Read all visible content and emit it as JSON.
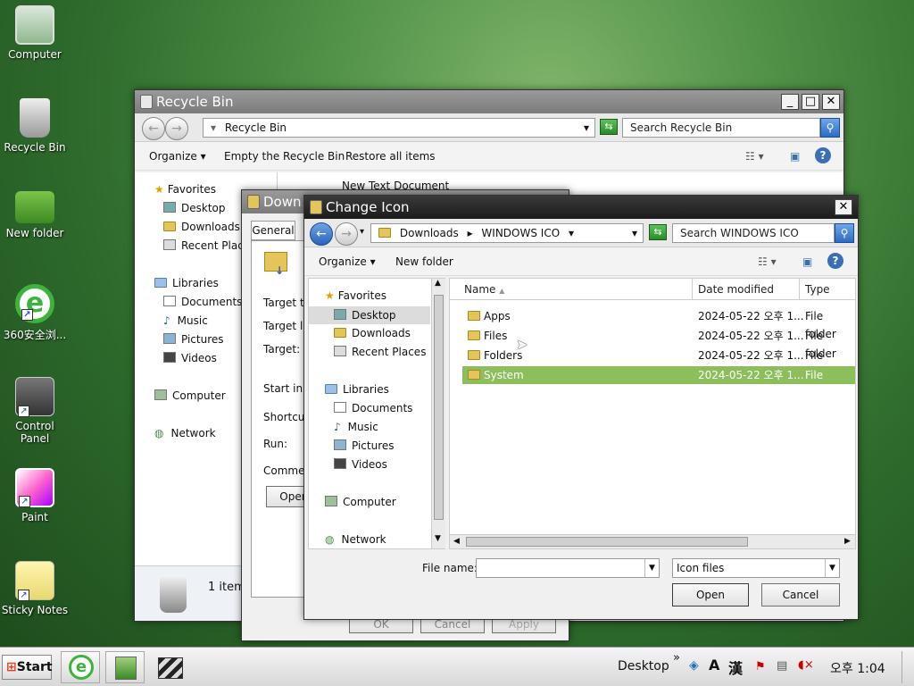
{
  "desktop": {
    "icons": [
      {
        "label": "Computer"
      },
      {
        "label": "Recycle Bin"
      },
      {
        "label": "New folder"
      },
      {
        "label": "360安全浏..."
      },
      {
        "label": "Control Panel"
      },
      {
        "label": "Paint"
      },
      {
        "label": "Sticky Notes"
      }
    ]
  },
  "recycle_bin": {
    "title": "Recycle Bin",
    "address": "Recycle Bin",
    "search_placeholder": "Search Recycle Bin",
    "commands": [
      "Organize",
      "Empty the Recycle Bin",
      "Restore all items"
    ],
    "nav": {
      "favorites": "Favorites",
      "desktop": "Desktop",
      "downloads": "Downloads",
      "recent": "Recent Places",
      "libraries": "Libraries",
      "documents": "Documents",
      "music": "Music",
      "pictures": "Pictures",
      "videos": "Videos",
      "computer": "Computer",
      "network": "Network"
    },
    "file_peek": "New Text Document",
    "status": "1 item"
  },
  "properties": {
    "title": "Down",
    "tab": "General",
    "labels": [
      "Target ty",
      "Target lo",
      "Target:",
      "Start in:",
      "Shortcut",
      "Run:",
      "Commer"
    ],
    "open_button": "Oper",
    "bottom_buttons": [
      "OK",
      "Cancel",
      "Apply"
    ]
  },
  "change_icon": {
    "title": "Change Icon",
    "breadcrumb": [
      "Downloads",
      "WINDOWS ICO"
    ],
    "search_placeholder": "Search WINDOWS ICO",
    "commands": [
      "Organize",
      "New folder"
    ],
    "nav": {
      "favorites": "Favorites",
      "desktop": "Desktop",
      "downloads": "Downloads",
      "recent": "Recent Places",
      "libraries": "Libraries",
      "documents": "Documents",
      "music": "Music",
      "pictures": "Pictures",
      "videos": "Videos",
      "computer": "Computer",
      "network": "Network"
    },
    "columns": {
      "name": "Name",
      "date": "Date modified",
      "type": "Type"
    },
    "files": [
      {
        "name": "Apps",
        "date": "2024-05-22 오후 1...",
        "type": "File folder",
        "selected": false
      },
      {
        "name": "Files",
        "date": "2024-05-22 오후 1...",
        "type": "File folder",
        "selected": false
      },
      {
        "name": "Folders",
        "date": "2024-05-22 오후 1...",
        "type": "File folder",
        "selected": false
      },
      {
        "name": "System",
        "date": "2024-05-22 오후 1...",
        "type": "File folder",
        "selected": true
      }
    ],
    "filename_label": "File name:",
    "filename_value": "",
    "filetype": "Icon files",
    "open_button": "Open",
    "cancel_button": "Cancel"
  },
  "taskbar": {
    "start_label": "Start",
    "desktop_label": "Desktop",
    "ime_a": "A",
    "ime_han": "漢",
    "clock": "오후 1:04",
    "chevron": "»"
  },
  "colors": {
    "selection": "#8cbf5c",
    "title_dark": "#1b1b1b"
  }
}
